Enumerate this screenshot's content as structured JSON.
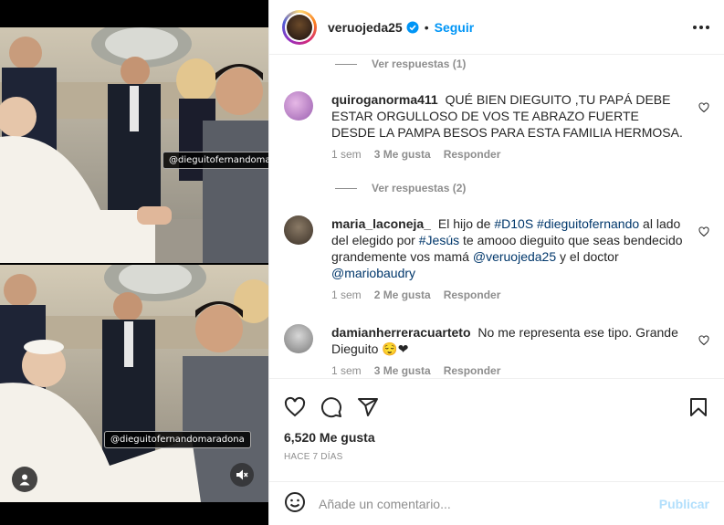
{
  "post": {
    "username": "veruojeda25",
    "follow_label": "Seguir",
    "separator": "•",
    "likes": "6,520 Me gusta",
    "date": "HACE 7 DÍAS",
    "media_tags": [
      "@dieguitofernandomaradona",
      "@dieguitofernandomaradona"
    ]
  },
  "comments": {
    "view_replies_1": "Ver respuestas (1)",
    "view_replies_2": "Ver respuestas (2)",
    "items": [
      {
        "user": "quiroganorma411",
        "text": "QUÉ BIEN DIEGUITO ,TU PAPÁ DEBE ESTAR ORGULLOSO DE VOS TE ABRAZO FUERTE DESDE LA PAMPA BESOS PARA ESTA FAMILIA HERMOSA.",
        "time": "1 sem",
        "likes": "3 Me gusta",
        "reply": "Responder"
      },
      {
        "user": "maria_laconeja_",
        "text_parts": [
          "El hijo de ",
          "#D10S",
          " ",
          "#dieguitofernando",
          " al lado del elegido por ",
          "#Jesús",
          " te amooo dieguito que seas bendecido grandemente vos mamá ",
          "@veruojeda25",
          " y el doctor ",
          "@mariobaudry"
        ],
        "time": "1 sem",
        "likes": "2 Me gusta",
        "reply": "Responder"
      },
      {
        "user": "damianherreracuarteto",
        "text": "No me representa ese tipo. Grande Dieguito",
        "emoji": "😌❤",
        "time": "1 sem",
        "likes": "3 Me gusta",
        "reply": "Responder"
      }
    ]
  },
  "composer": {
    "placeholder": "Añade un comentario...",
    "publish_label": "Publicar"
  },
  "icons": {
    "like": "heart-icon",
    "comment": "comment-icon",
    "share": "paper-plane-icon",
    "save": "bookmark-icon",
    "emoji": "smiley-icon",
    "more": "more-dots-icon",
    "verified": "verified-badge-icon",
    "user_tag": "user-tag-icon",
    "mute": "muted-speaker-icon"
  },
  "colors": {
    "accent": "#0095f6",
    "publish_disabled": "#b2dffc",
    "link": "#00376b",
    "muted": "#8e8e8e"
  }
}
